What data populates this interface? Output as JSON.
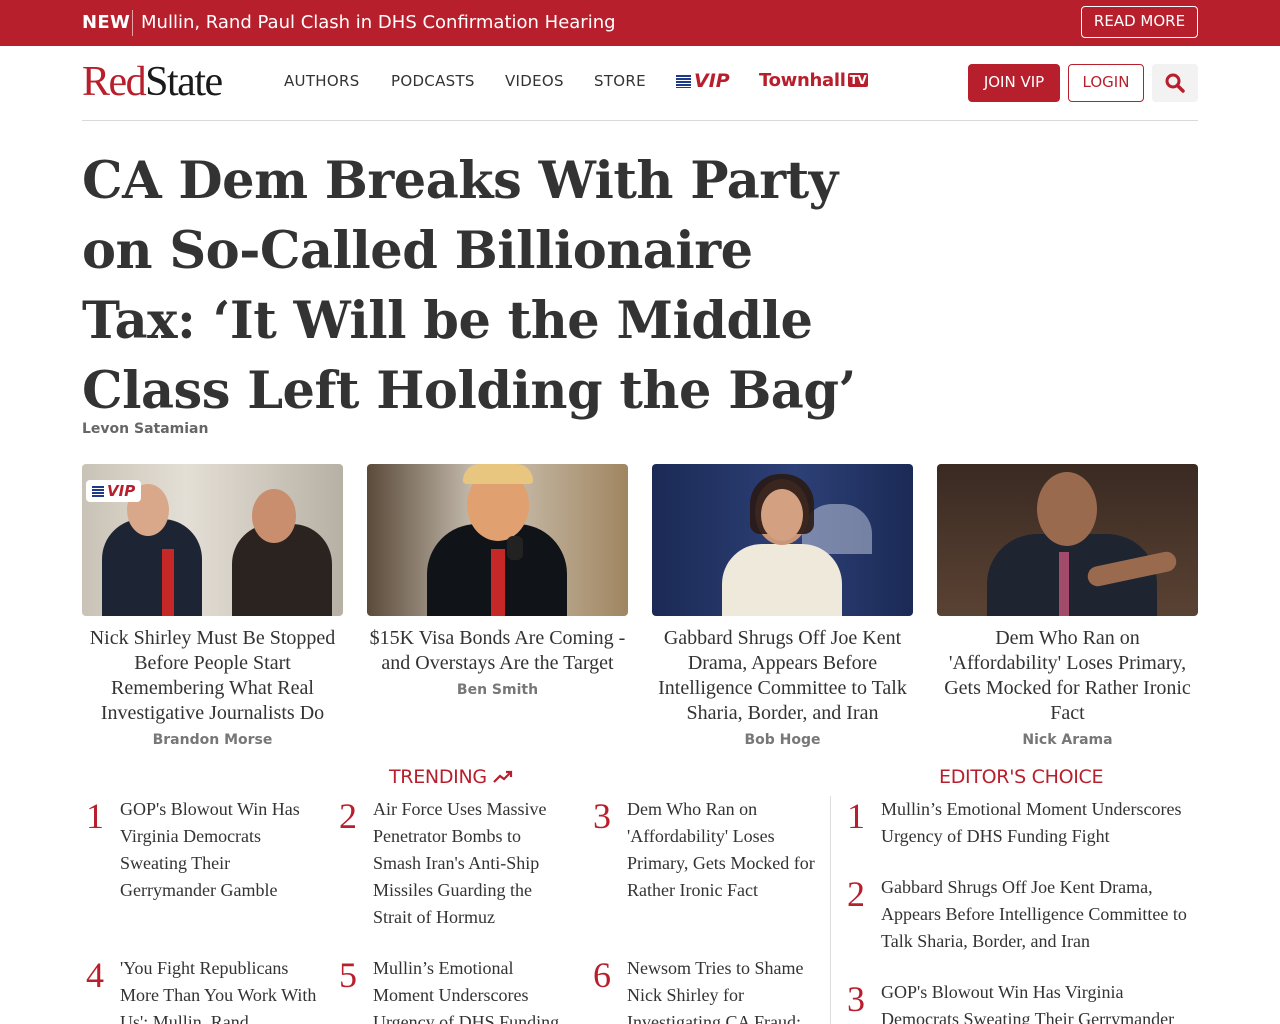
{
  "topbar": {
    "label": "NEW",
    "headline": "Mullin, Rand Paul Clash in DHS Confirmation Hearing",
    "read_more": "READ MORE"
  },
  "header": {
    "logo_red": "Red",
    "logo_dark": "State",
    "nav": [
      "AUTHORS",
      "PODCASTS",
      "VIDEOS",
      "STORE"
    ],
    "vip_label": "VIP",
    "townhall_label": "Townhall",
    "townhall_tv": "TV",
    "join_vip": "JOIN VIP",
    "login": "LOGIN",
    "search_icon": "search-icon"
  },
  "main_story": {
    "title": "CA Dem Breaks With Party on So-Called Billionaire Tax: ‘It Will be the Middle Class Left Holding the Bag’",
    "author": "Levon Satamian"
  },
  "cards": [
    {
      "vip": "VIP",
      "title": "Nick Shirley Must Be Stopped Before People Start Remembering What Real Investigative Journalists Do",
      "author": "Brandon Morse"
    },
    {
      "title": "$15K Visa Bonds Are Coming - and Overstays Are the Target",
      "author": "Ben Smith"
    },
    {
      "title": "Gabbard Shrugs Off Joe Kent Drama, Appears Before Intelligence Committee to Talk Sharia, Border, and Iran",
      "author": "Bob Hoge"
    },
    {
      "title": "Dem Who Ran on 'Affordability' Loses Primary, Gets Mocked for Rather Ironic Fact",
      "author": "Nick Arama"
    }
  ],
  "trending": {
    "heading": "TRENDING",
    "items": [
      {
        "rank": "1",
        "title": "GOP's Blowout Win Has Virginia Democrats Sweating Their Gerrymander Gamble"
      },
      {
        "rank": "2",
        "title": "Air Force Uses Massive Penetrator Bombs to Smash Iran's Anti-Ship Missiles Guarding the Strait of Hormuz"
      },
      {
        "rank": "3",
        "title": "Dem Who Ran on 'Affordability' Loses Primary, Gets Mocked for Rather Ironic Fact"
      },
      {
        "rank": "4",
        "title": "'You Fight Republicans More Than You Work With Us': Mullin, Rand"
      },
      {
        "rank": "5",
        "title": "Mullin’s Emotional Moment Underscores Urgency of DHS Funding"
      },
      {
        "rank": "6",
        "title": "Newsom Tries to Shame Nick Shirley for Investigating CA Fraud;"
      }
    ]
  },
  "editors_choice": {
    "heading": "EDITOR'S CHOICE",
    "items": [
      {
        "rank": "1",
        "title": "Mullin’s Emotional Moment Underscores Urgency of DHS Funding Fight"
      },
      {
        "rank": "2",
        "title": "Gabbard Shrugs Off Joe Kent Drama, Appears Before Intelligence Committee to Talk Sharia, Border, and Iran"
      },
      {
        "rank": "3",
        "title": "GOP's Blowout Win Has Virginia Democrats Sweating Their Gerrymander"
      }
    ]
  },
  "colors": {
    "brand_red": "#b81f2c",
    "text": "#333333",
    "muted": "#777777"
  }
}
